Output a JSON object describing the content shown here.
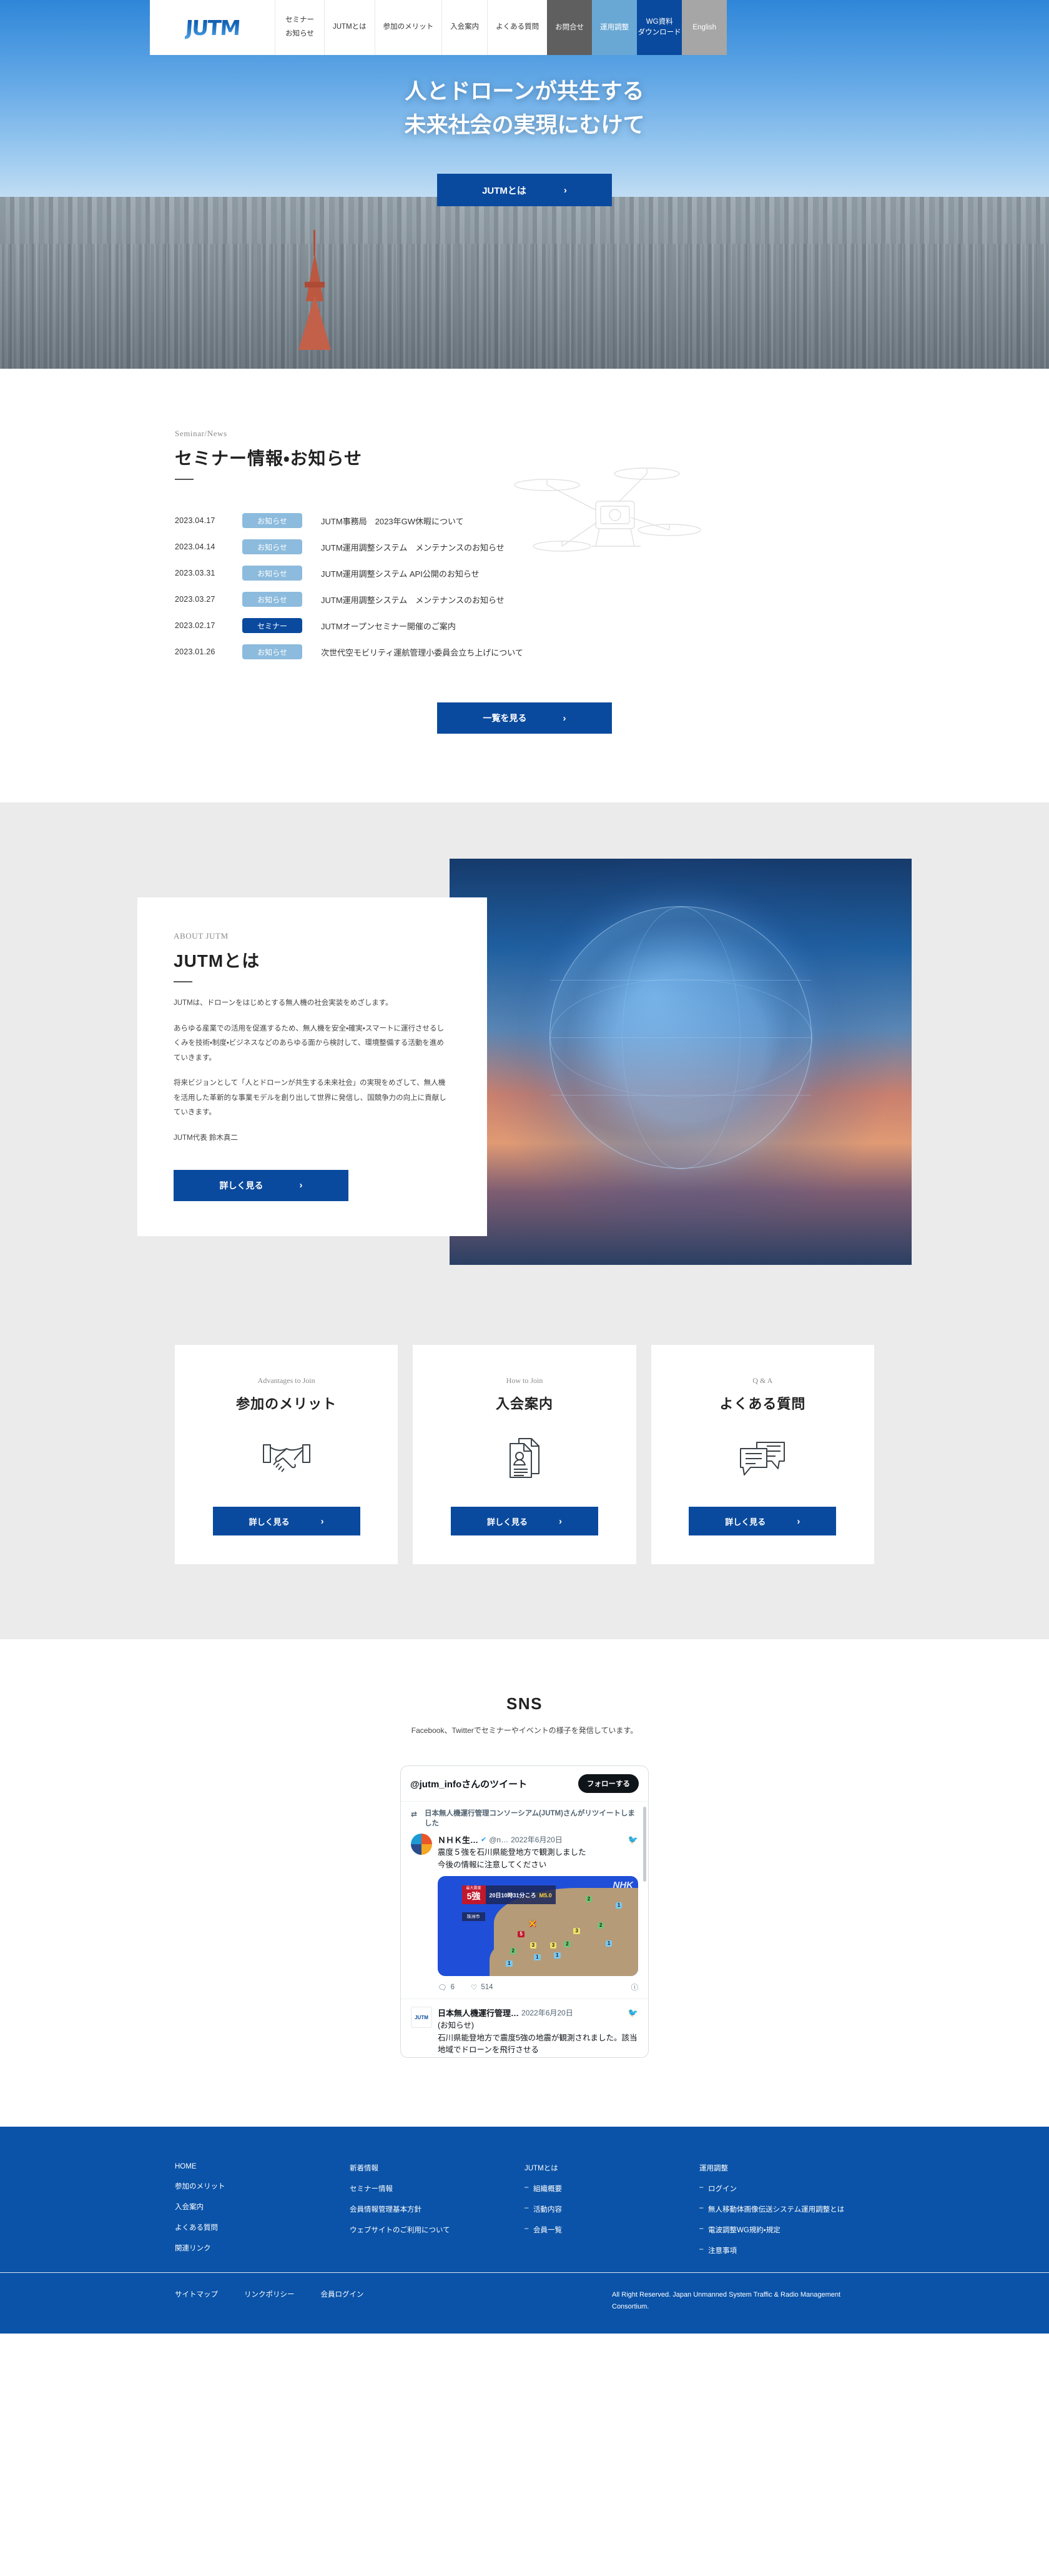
{
  "header": {
    "logo_text": "JUTM",
    "nav": [
      {
        "line1": "セミナー",
        "line2": "お知らせ"
      },
      {
        "line1": "JUTMとは",
        "line2": ""
      },
      {
        "line1": "参加のメリット",
        "line2": ""
      },
      {
        "line1": "入会案内",
        "line2": ""
      },
      {
        "line1": "よくある質問",
        "line2": ""
      }
    ],
    "buttons": [
      {
        "line1": "お問合せ",
        "line2": "",
        "color": "#5f5f5f"
      },
      {
        "line1": "運用調整",
        "line2": "",
        "color": "#69a8d4"
      },
      {
        "line1": "WG資料",
        "line2": "ダウンロード",
        "color": "#0a4a9e"
      },
      {
        "line1": "English",
        "line2": "",
        "color": "#a6a6a6"
      }
    ]
  },
  "hero": {
    "headline_line1": "人とドローンが共生する",
    "headline_line2": "未来社会の実現にむけて",
    "cta_label": "JUTMとは",
    "cta_chevron": "›"
  },
  "news": {
    "label_en": "Seminar/News",
    "title": "セミナー情報・お知らせ",
    "items": [
      {
        "date": "2023.04.17",
        "badge": "お知らせ",
        "badge_type": "info",
        "title": "JUTM事務局　2023年GW休暇について"
      },
      {
        "date": "2023.04.14",
        "badge": "お知らせ",
        "badge_type": "info",
        "title": "JUTM運用調整システム　メンテナンスのお知らせ"
      },
      {
        "date": "2023.03.31",
        "badge": "お知らせ",
        "badge_type": "info",
        "title": "JUTM運用調整システム API公開のお知らせ"
      },
      {
        "date": "2023.03.27",
        "badge": "お知らせ",
        "badge_type": "info",
        "title": "JUTM運用調整システム　メンテナンスのお知らせ"
      },
      {
        "date": "2023.02.17",
        "badge": "セミナー",
        "badge_type": "seminar",
        "title": "JUTMオープンセミナー開催のご案内"
      },
      {
        "date": "2023.01.26",
        "badge": "お知らせ",
        "badge_type": "info",
        "title": "次世代空モビリティ運航管理小委員会立ち上げについて"
      }
    ],
    "more_label": "一覧を見る",
    "more_chevron": "›"
  },
  "about": {
    "label_en": "ABOUT JUTM",
    "title": "JUTMとは",
    "paragraphs": [
      "JUTMは、ドローンをはじめとする無人機の社会実装をめざします。",
      "あらゆる産業での活用を促進するため、無人機を安全・確実・スマートに運行させるしくみを技術・制度・ビジネスなどのあらゆる面から検討して、環境整備する活動を進めていきます。",
      "将来ビジョンとして「人とドローンが共生する未来社会」の実現をめざして、無人機を活用した革新的な事業モデルを創り出して世界に発信し、国競争力の向上に貢献していきます。",
      "JUTM代表 鈴木真二"
    ],
    "cta_label": "詳しく見る",
    "cta_chevron": "›"
  },
  "cards": [
    {
      "label_en": "Advantages to Join",
      "title": "参加のメリット",
      "icon": "handshake-icon",
      "cta_label": "詳しく見る",
      "cta_chevron": "›"
    },
    {
      "label_en": "How to Join",
      "title": "入会案内",
      "icon": "document-person-icon",
      "cta_label": "詳しく見る",
      "cta_chevron": "›"
    },
    {
      "label_en": "Q & A",
      "title": "よくある質問",
      "icon": "speech-bubbles-icon",
      "cta_label": "詳しく見る",
      "cta_chevron": "›"
    }
  ],
  "sns": {
    "title": "SNS",
    "subtitle": "Facebook、Twitterでセミナーやイベントの様子を発信しています。",
    "widget": {
      "header_title": "@jutm_infoさんのツイート",
      "follow_label": "フォローする",
      "tweets": [
        {
          "retweet_note": "日本無人機運行管理コンソーシアム(JUTM)さんがリツイートしました",
          "author": "ＮＨＫ生…",
          "verified": true,
          "handle": "@n…",
          "date": "2022年6月20日",
          "text_line1": "震度５強を石川県能登地方で観測しました",
          "text_line2": "今後の情報に注意してください",
          "media": {
            "badge_label": "最大震度",
            "badge_value": "5強",
            "city": "珠洲市",
            "time": "20日10時31分ころ",
            "magnitude": "M5.0",
            "source": "NHK"
          },
          "replies": "6",
          "likes": "514"
        },
        {
          "author": "日本無人機運行管理…",
          "date": "2022年6月20日",
          "text_line1": "(お知らせ)",
          "text_line2": "石川県能登地方で震度5強の地震が観測されました。該当地域でドローンを飛行させる"
        }
      ]
    }
  },
  "footer": {
    "columns": [
      {
        "links": [
          "HOME",
          "参加のメリット",
          "入会案内",
          "よくある質問",
          "関連リンク"
        ],
        "subs": []
      },
      {
        "links": [
          "新着情報",
          "セミナー情報",
          "会員情報管理基本方針",
          "ウェブサイトのご利用について"
        ],
        "subs": []
      },
      {
        "links": [
          "JUTMとは"
        ],
        "subs": [
          "組織概要",
          "活動内容",
          "会員一覧"
        ]
      },
      {
        "links": [
          "運用調整"
        ],
        "subs": [
          "ログイン",
          "無人移動体画像伝送システム運用調整とは",
          "電波調整WG規約・規定",
          "注意事項"
        ]
      }
    ],
    "bottom_links": [
      "サイトマップ",
      "リンクポリシー",
      "会員ログイン"
    ],
    "copyright": "All Right Reserved. Japan Unmanned System Traffic & Radio Management Consortium."
  }
}
